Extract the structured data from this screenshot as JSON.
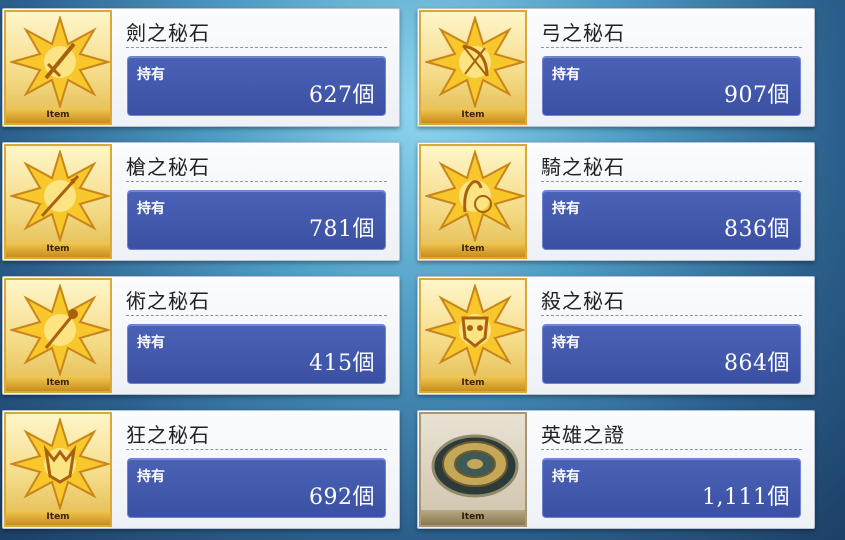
{
  "item_tag": "Item",
  "owned_label": "持有",
  "items": [
    {
      "name": "劍之秘石",
      "count": "627個",
      "icon": "saber-gem-icon"
    },
    {
      "name": "弓之秘石",
      "count": "907個",
      "icon": "archer-gem-icon"
    },
    {
      "name": "槍之秘石",
      "count": "781個",
      "icon": "lancer-gem-icon"
    },
    {
      "name": "騎之秘石",
      "count": "836個",
      "icon": "rider-gem-icon"
    },
    {
      "name": "術之秘石",
      "count": "415個",
      "icon": "caster-gem-icon"
    },
    {
      "name": "殺之秘石",
      "count": "864個",
      "icon": "assassin-gem-icon"
    },
    {
      "name": "狂之秘石",
      "count": "692個",
      "icon": "berserker-gem-icon"
    },
    {
      "name": "英雄之證",
      "count": "1,111個",
      "icon": "proof-of-hero-icon"
    }
  ]
}
